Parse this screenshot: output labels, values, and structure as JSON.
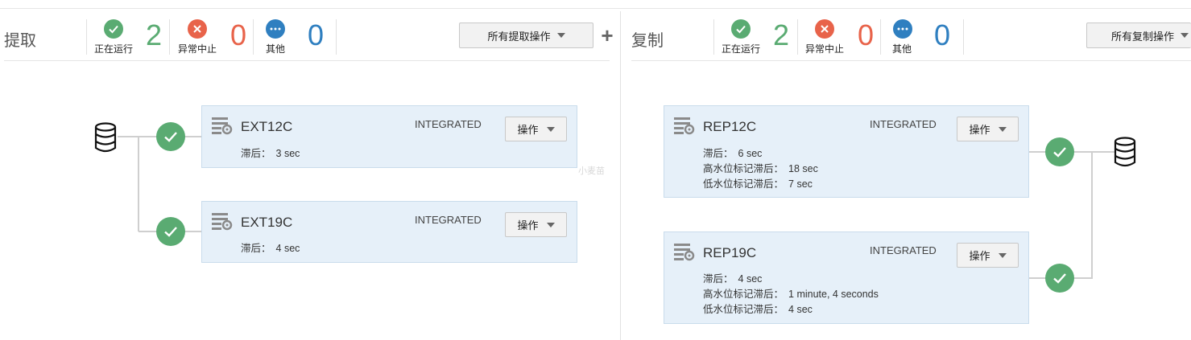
{
  "extract": {
    "title": "提取",
    "stats": [
      {
        "label": "正在运行",
        "count": "2",
        "icon": "check-icon",
        "color": "#5aab72"
      },
      {
        "label": "异常中止",
        "count": "0",
        "icon": "x-icon",
        "color": "#e8634a"
      },
      {
        "label": "其他",
        "count": "0",
        "icon": "ellipsis-icon",
        "color": "#2f7fc0"
      }
    ],
    "all_button": "所有提取操作",
    "processes": [
      {
        "name": "EXT12C",
        "mode": "INTEGRATED",
        "ops": "操作",
        "rows": [
          {
            "key": "滞后：",
            "value": "3 sec"
          }
        ]
      },
      {
        "name": "EXT19C",
        "mode": "INTEGRATED",
        "ops": "操作",
        "rows": [
          {
            "key": "滞后：",
            "value": "4 sec"
          }
        ]
      }
    ]
  },
  "replicat": {
    "title": "复制",
    "stats": [
      {
        "label": "正在运行",
        "count": "2",
        "icon": "check-icon",
        "color": "#5aab72"
      },
      {
        "label": "异常中止",
        "count": "0",
        "icon": "x-icon",
        "color": "#e8634a"
      },
      {
        "label": "其他",
        "count": "0",
        "icon": "ellipsis-icon",
        "color": "#2f7fc0"
      }
    ],
    "all_button": "所有复制操作",
    "processes": [
      {
        "name": "REP12C",
        "mode": "INTEGRATED",
        "ops": "操作",
        "rows": [
          {
            "key": "滞后：",
            "value": "6 sec"
          },
          {
            "key": "高水位标记滞后：",
            "value": "18 sec"
          },
          {
            "key": "低水位标记滞后：",
            "value": "7 sec"
          }
        ]
      },
      {
        "name": "REP19C",
        "mode": "INTEGRATED",
        "ops": "操作",
        "rows": [
          {
            "key": "滞后：",
            "value": "4 sec"
          },
          {
            "key": "高水位标记滞后：",
            "value": "1 minute, 4 seconds"
          },
          {
            "key": "低水位标记滞后：",
            "value": "4 sec"
          }
        ]
      }
    ]
  },
  "watermark": "小麦苗"
}
